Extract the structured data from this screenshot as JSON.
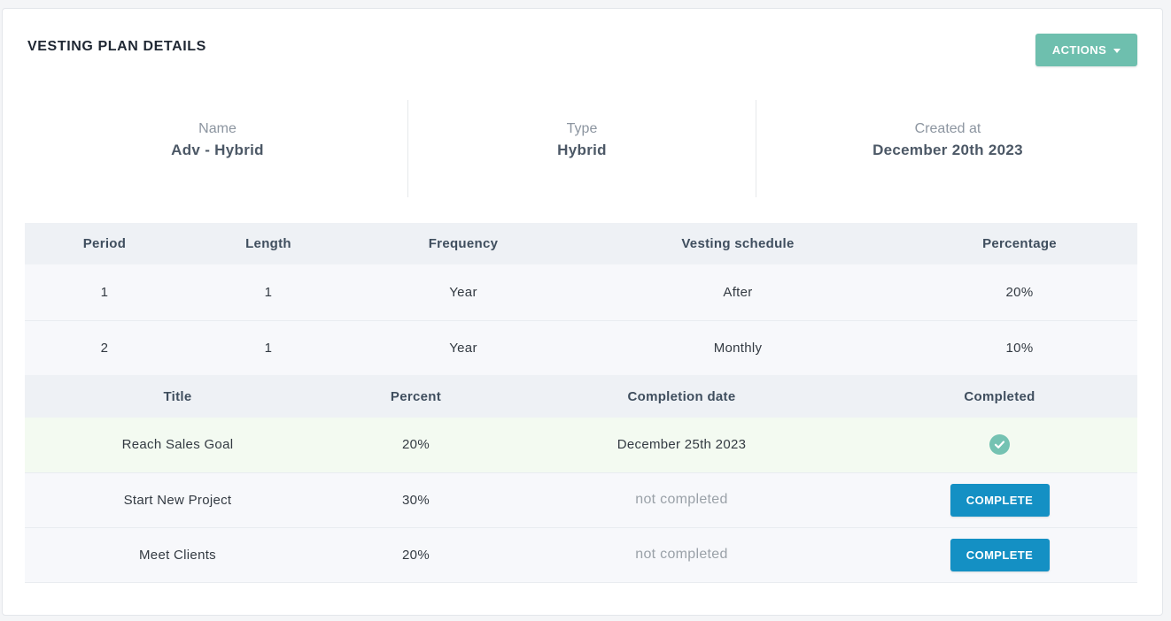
{
  "card": {
    "title": "VESTING PLAN DETAILS",
    "actions_label": "ACTIONS"
  },
  "info": {
    "name_label": "Name",
    "name_value": "Adv - Hybrid",
    "type_label": "Type",
    "type_value": "Hybrid",
    "created_label": "Created at",
    "created_value": "December 20th 2023"
  },
  "periods": {
    "headers": [
      "Period",
      "Length",
      "Frequency",
      "Vesting schedule",
      "Percentage"
    ],
    "rows": [
      [
        "1",
        "1",
        "Year",
        "After",
        "20%"
      ],
      [
        "2",
        "1",
        "Year",
        "Monthly",
        "10%"
      ]
    ]
  },
  "milestones": {
    "headers": [
      "Title",
      "Percent",
      "Completion date",
      "Completed"
    ],
    "rows": [
      {
        "title": "Reach Sales Goal",
        "percent": "20%",
        "date": "December 25th 2023",
        "completed": true
      },
      {
        "title": "Start New Project",
        "percent": "30%",
        "date": "not completed",
        "button": "COMPLETE"
      },
      {
        "title": "Meet Clients",
        "percent": "20%",
        "date": "not completed",
        "button": "COMPLETE"
      }
    ]
  },
  "colors": {
    "actions_button": "#6ebfae",
    "complete_button": "#1490c4",
    "check_icon": "#74c2b2",
    "header_bg": "#eef1f5",
    "completed_row_bg": "#f3faf1"
  }
}
